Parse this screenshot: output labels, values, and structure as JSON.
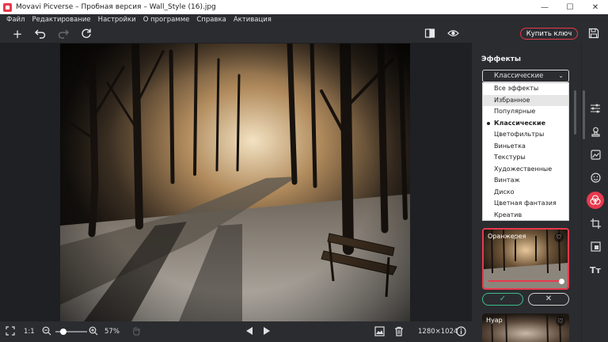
{
  "window": {
    "title": "Movavi Picverse – Пробная версия – Wall_Style (16).jpg",
    "minimize": "—",
    "maximize": "☐",
    "close": "✕"
  },
  "menu": [
    "Файл",
    "Редактирование",
    "Настройки",
    "О программе",
    "Справка",
    "Активация"
  ],
  "toolbar": {
    "buy_label": "Купить ключ"
  },
  "bottombar": {
    "ratio_label": "1:1",
    "zoom_percent": "57%",
    "zoom_level": 0.25,
    "image_size": "1280×1024"
  },
  "panel": {
    "title": "Эффекты",
    "select_value": "Классические",
    "dropdown_items": [
      "Все эффекты",
      "Избранное",
      "Популярные",
      "Классические",
      "Цветофильтры",
      "Виньетка",
      "Текстуры",
      "Художественные",
      "Винтаж",
      "Диско",
      "Цветная фантазия",
      "Креатив"
    ],
    "hovered_index": 1,
    "selected_index": 3,
    "cards": [
      {
        "label": "Оранжерея",
        "active": true
      },
      {
        "label": "Нуар",
        "active": false
      }
    ],
    "ok_label": "✓",
    "cancel_label": "✕"
  },
  "colors": {
    "accent": "#e8394d",
    "confirm": "#3bbf8a",
    "background": "#1f2023",
    "panel": "#2b2c30"
  },
  "icons": {
    "rail": [
      "adjust-sliders-icon",
      "stamp-icon",
      "image-enhance-icon",
      "retouch-face-icon",
      "effects-icon",
      "crop-icon",
      "replace-background-icon",
      "text-icon"
    ],
    "active_rail": "effects-icon"
  }
}
